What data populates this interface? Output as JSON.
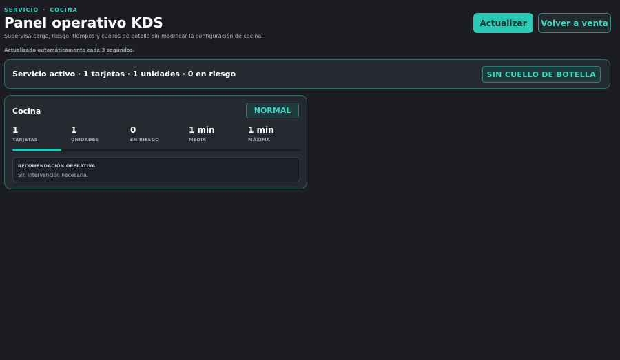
{
  "breadcrumb": {
    "section": "SERVICIO",
    "separator": "·",
    "area": "COCINA"
  },
  "header": {
    "title": "Panel operativo KDS",
    "subtitle": "Supervisa carga, riesgo, tiempos y cuellos de botella sin modificar la configuración de cocina.",
    "auto_update": "Actualizado automáticamente cada 3 segundos."
  },
  "actions": {
    "refresh_label": "Actualizar",
    "back_label": "Volver a venta"
  },
  "summary": {
    "text": "Servicio activo · 1 tarjetas · 1 unidades · 0 en riesgo",
    "bottleneck_badge": "SIN CUELLO DE BOTELLA"
  },
  "stations": [
    {
      "name": "Cocina",
      "status": "NORMAL",
      "metrics": [
        {
          "value": "1",
          "label": "TARJETAS"
        },
        {
          "value": "1",
          "label": "UNIDADES"
        },
        {
          "value": "0",
          "label": "EN RIESGO"
        },
        {
          "value": "1 min",
          "label": "MEDIA"
        },
        {
          "value": "1 min",
          "label": "MÁXIMA"
        }
      ],
      "load_fraction": 0.17,
      "recommendation": {
        "title": "RECOMENDACIÓN OPERATIVA",
        "text": "Sin intervención necesaria."
      }
    }
  ],
  "colors": {
    "background": "#1b1d23",
    "accent": "#2bc7b5",
    "card": "#252a31",
    "card_border": "#2e6b66"
  }
}
